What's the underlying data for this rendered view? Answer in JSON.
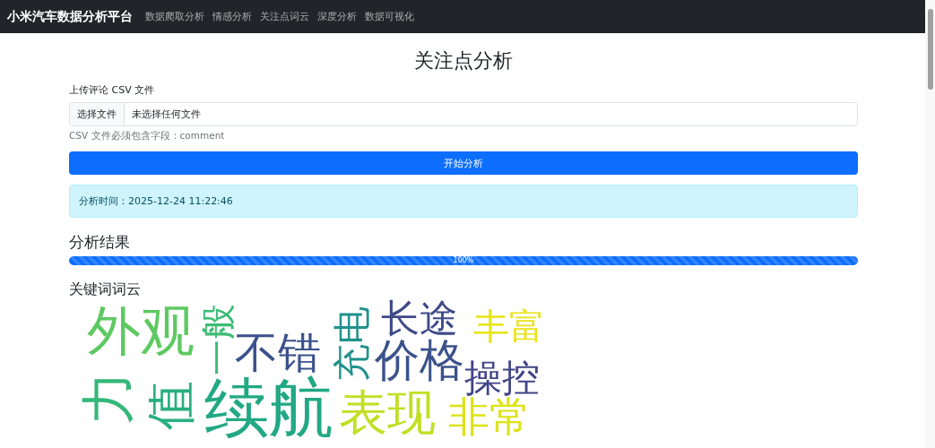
{
  "navbar": {
    "brand": "小米汽车数据分析平台",
    "links": [
      {
        "label": "数据爬取分析"
      },
      {
        "label": "情感分析"
      },
      {
        "label": "关注点词云"
      },
      {
        "label": "深度分析"
      },
      {
        "label": "数据可视化"
      }
    ]
  },
  "page_title": "关注点分析",
  "upload": {
    "label": "上传评论 CSV 文件",
    "choose_button": "选择文件",
    "file_status": "未选择任何文件",
    "help": "CSV 文件必须包含字段：comment"
  },
  "submit_button": "开始分析",
  "alert": "分析时间：2025-12-24 11:22:46",
  "results": {
    "heading": "分析结果",
    "progress": {
      "level": 1.0,
      "label": "100%"
    }
  },
  "word_cloud": {
    "heading": "关键词词云",
    "words": [
      {
        "text": "外观",
        "color": "#5ec962",
        "vertical": false
      },
      {
        "text": "一般",
        "color": "#3dbc74",
        "vertical": true
      },
      {
        "text": "不错",
        "color": "#3b528b",
        "vertical": false
      },
      {
        "text": "充电",
        "color": "#21918c",
        "vertical": true
      },
      {
        "text": "长途",
        "color": "#3e4a89",
        "vertical": false
      },
      {
        "text": "价格",
        "color": "#3b528b",
        "vertical": false
      },
      {
        "text": "丰富",
        "color": "#e8e419",
        "vertical": false
      },
      {
        "text": "操控",
        "color": "#414487",
        "vertical": false
      },
      {
        "text": "力",
        "color": "#35b779",
        "vertical": true
      },
      {
        "text": "值",
        "color": "#29af7f",
        "vertical": true
      },
      {
        "text": "续航",
        "color": "#22a884",
        "vertical": false
      },
      {
        "text": "表现",
        "color": "#c2df23",
        "vertical": false
      },
      {
        "text": "非常",
        "color": "#dde318",
        "vertical": false
      }
    ]
  }
}
